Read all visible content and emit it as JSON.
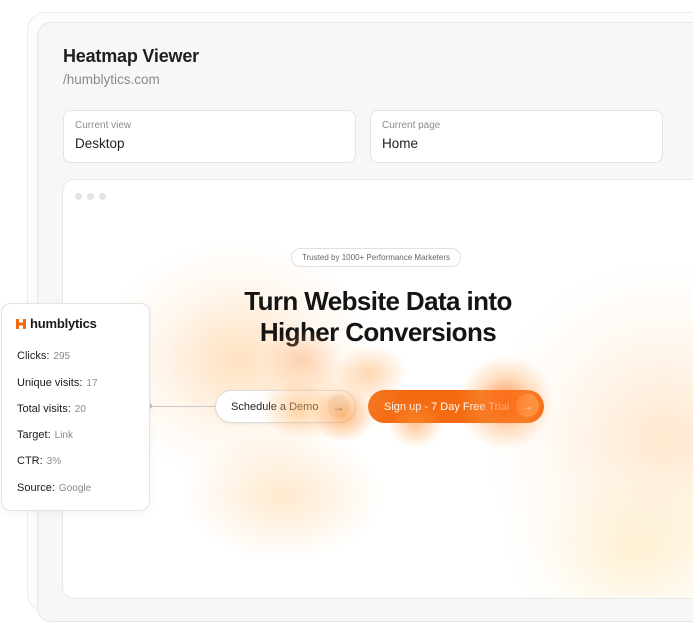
{
  "app": {
    "title": "Heatmap Viewer",
    "subtitle": "/humblytics.com"
  },
  "fields": {
    "view": {
      "label": "Current view",
      "value": "Desktop"
    },
    "page": {
      "label": "Current page",
      "value": "Home"
    }
  },
  "preview": {
    "badge": "Trusted by 1000+ Performance Marketers",
    "hero_line1": "Turn Website Data into",
    "hero_line2": "Higher Conversions",
    "demo_button": "Schedule a Demo",
    "signup_button": "Sign up - 7 Day Free Trial",
    "arrow_glyph": "→"
  },
  "stats": {
    "brand": "humblytics",
    "rows": [
      {
        "label": "Clicks:",
        "value": "295"
      },
      {
        "label": "Unique visits:",
        "value": "17"
      },
      {
        "label": "Total visits:",
        "value": "20"
      },
      {
        "label": "Target:",
        "value": "Link"
      },
      {
        "label": "CTR:",
        "value": "3%"
      },
      {
        "label": "Source:",
        "value": "Google"
      }
    ]
  },
  "colors": {
    "accent": "#f36a10",
    "accent_light": "#ff8a3a",
    "muted_text": "#8a8a8a"
  }
}
